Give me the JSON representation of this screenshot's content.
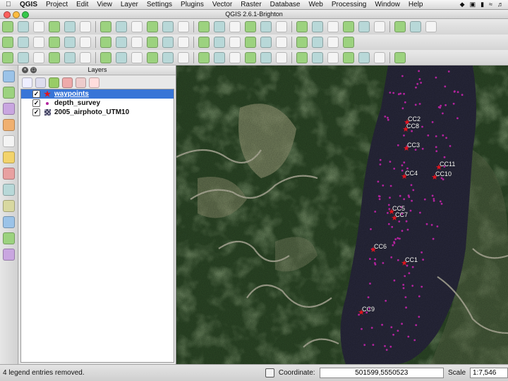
{
  "menubar": {
    "app": "QGIS",
    "items": [
      "Project",
      "Edit",
      "View",
      "Layer",
      "Settings",
      "Plugins",
      "Vector",
      "Raster",
      "Database",
      "Web",
      "Processing",
      "Window",
      "Help"
    ]
  },
  "window": {
    "title": "QGIS 2.6.1-Brighton"
  },
  "layers_panel": {
    "title": "Layers",
    "layers": [
      {
        "name": "waypoints",
        "checked": true,
        "selected": true,
        "symbol": "red-star-icon"
      },
      {
        "name": "depth_survey",
        "checked": true,
        "selected": false,
        "symbol": "purple-dot-icon"
      },
      {
        "name": "2005_airphoto_UTM10",
        "checked": true,
        "selected": false,
        "symbol": "raster-icon"
      }
    ]
  },
  "map": {
    "waypoints": [
      "CC2",
      "CC8",
      "CC3",
      "CC11",
      "CC4",
      "CC10",
      "CC5",
      "CC7",
      "CC6",
      "CC1",
      "CC9"
    ]
  },
  "statusbar": {
    "message": "4 legend entries removed.",
    "coordinate_label": "Coordinate:",
    "coordinate_value": "501599,5550523",
    "scale_label": "Scale",
    "scale_value": "1:7,546"
  },
  "colors": {
    "selection": "#3875d7",
    "waypoint": "#e0141e",
    "depth_point": "#b3239e",
    "lake": "#2a2a3e"
  }
}
